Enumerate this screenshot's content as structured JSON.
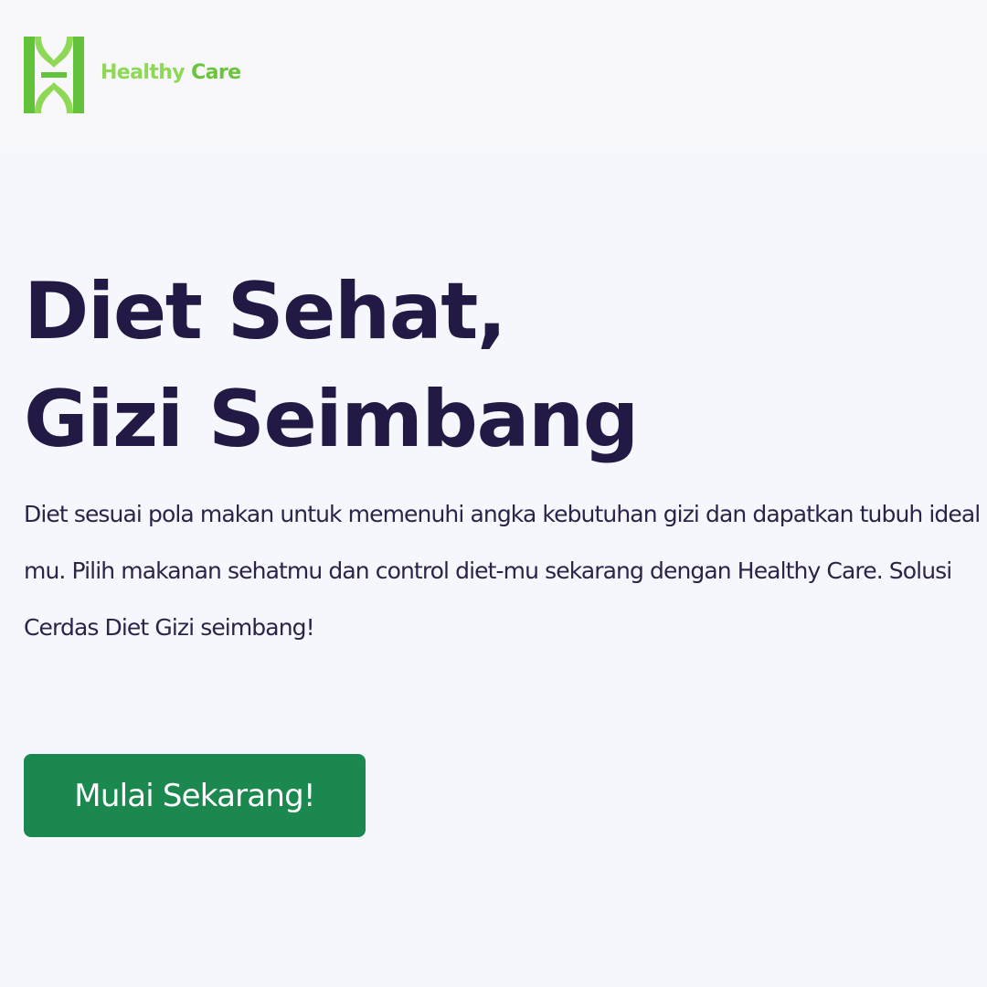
{
  "brand": {
    "logo_icon": "healthy-care-logo-icon",
    "name_part1": "Healthy",
    "name_part2": "Care",
    "colors": {
      "light_green": "#8fd856",
      "green": "#6cc43d"
    }
  },
  "hero": {
    "title_line1": "Diet Sehat,",
    "title_line2": "Gizi Seimbang",
    "description": "Diet sesuai pola makan untuk memenuhi angka kebutuhan gizi dan dapatkan tubuh ideal mu. Pilih makanan sehatmu dan control diet-mu sekarang dengan Healthy Care. Solusi Cerdas Diet Gizi seimbang!",
    "cta_label": "Mulai Sekarang!"
  },
  "colors": {
    "background": "#f6f7fc",
    "title": "#221a45",
    "text": "#2a2448",
    "cta": "#1b8850"
  }
}
